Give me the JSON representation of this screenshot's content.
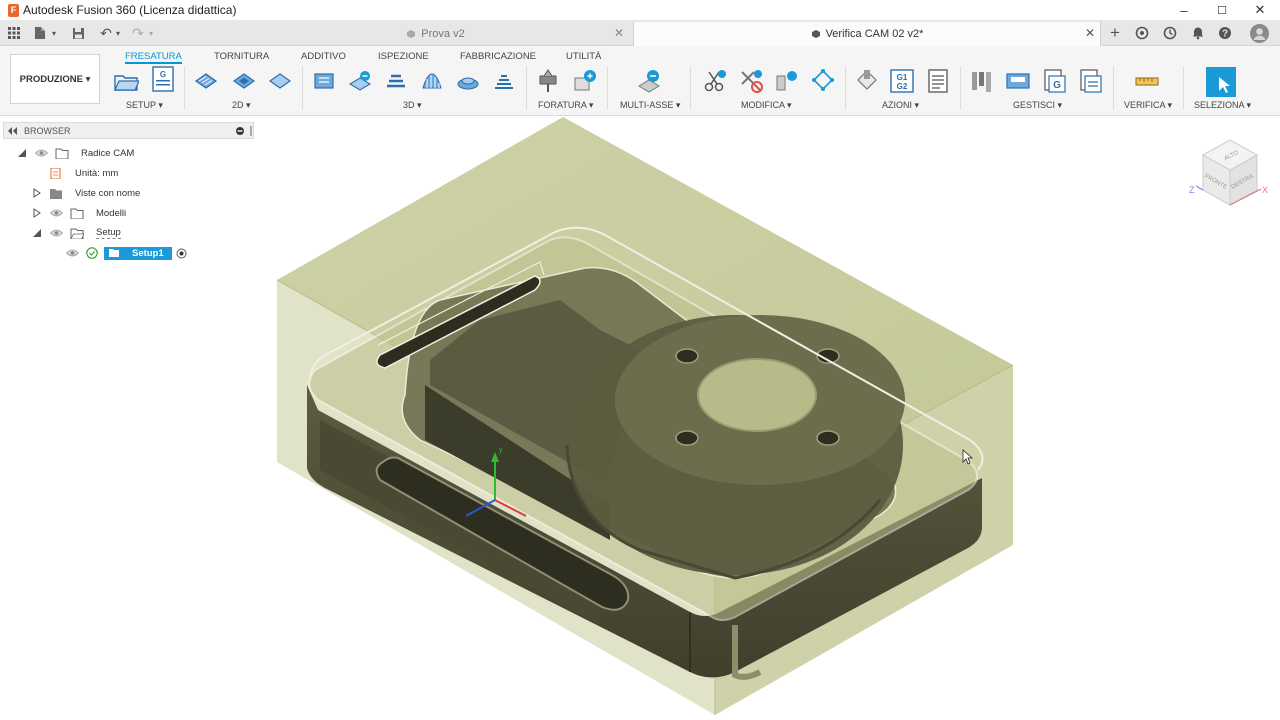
{
  "app": {
    "title": "Autodesk Fusion 360 (Licenza didattica)",
    "logo": "fusion-logo-icon",
    "accent_color": "#0696d7",
    "brand_color": "#e4692a"
  },
  "window_controls": {
    "minimize": "–",
    "maximize": "☐",
    "close": "✕"
  },
  "doc_tabs": [
    {
      "label": "Prova v2",
      "active": false,
      "close": "✕"
    },
    {
      "label": "Verifica CAM 02 v2*",
      "active": true,
      "close": "✕"
    }
  ],
  "tabbar_glyphs": {
    "new_tab": "+",
    "undo": "↶",
    "redo": "↷",
    "dropdown": "▾"
  },
  "ribbon": {
    "tabs": [
      "FRESATURA",
      "TORNITURA",
      "ADDITIVO",
      "ISPEZIONE",
      "FABBRICAZIONE",
      "UTILITÀ"
    ],
    "active_tab": "FRESATURA",
    "workspace": "PRODUZIONE ▾",
    "groups": [
      "SETUP ▾",
      "2D ▾",
      "3D ▾",
      "FORATURA ▾",
      "MULTI-ASSE ▾",
      "MODIFICA ▾",
      "AZIONI ▾",
      "GESTISCI ▾",
      "VERIFICA ▾",
      "SELEZIONA ▾"
    ],
    "tool_glyphs": {
      "nc_program": "G",
      "post": "G1\nG2"
    }
  },
  "browser": {
    "title": "BROWSER",
    "items": [
      {
        "label": "Radice CAM",
        "level": 0
      },
      {
        "label": "Unità: mm",
        "level": 1
      },
      {
        "label": "Viste con nome",
        "level": 1
      },
      {
        "label": "Modelli",
        "level": 1
      },
      {
        "label": "Setup",
        "level": 1
      },
      {
        "label": "Setup1",
        "level": 2,
        "selected": true
      }
    ]
  },
  "viewcube": {
    "top": "ALTO",
    "front": "FRONTE",
    "right": "DESTRA",
    "axis_x": "X",
    "axis_z": "Z"
  },
  "model": {
    "stock_color": "#c5c99a",
    "part_color": "#6e6e50",
    "axis_colors": {
      "x": "#e03a3a",
      "y": "#2ebd2e",
      "z": "#2a55d8"
    }
  }
}
